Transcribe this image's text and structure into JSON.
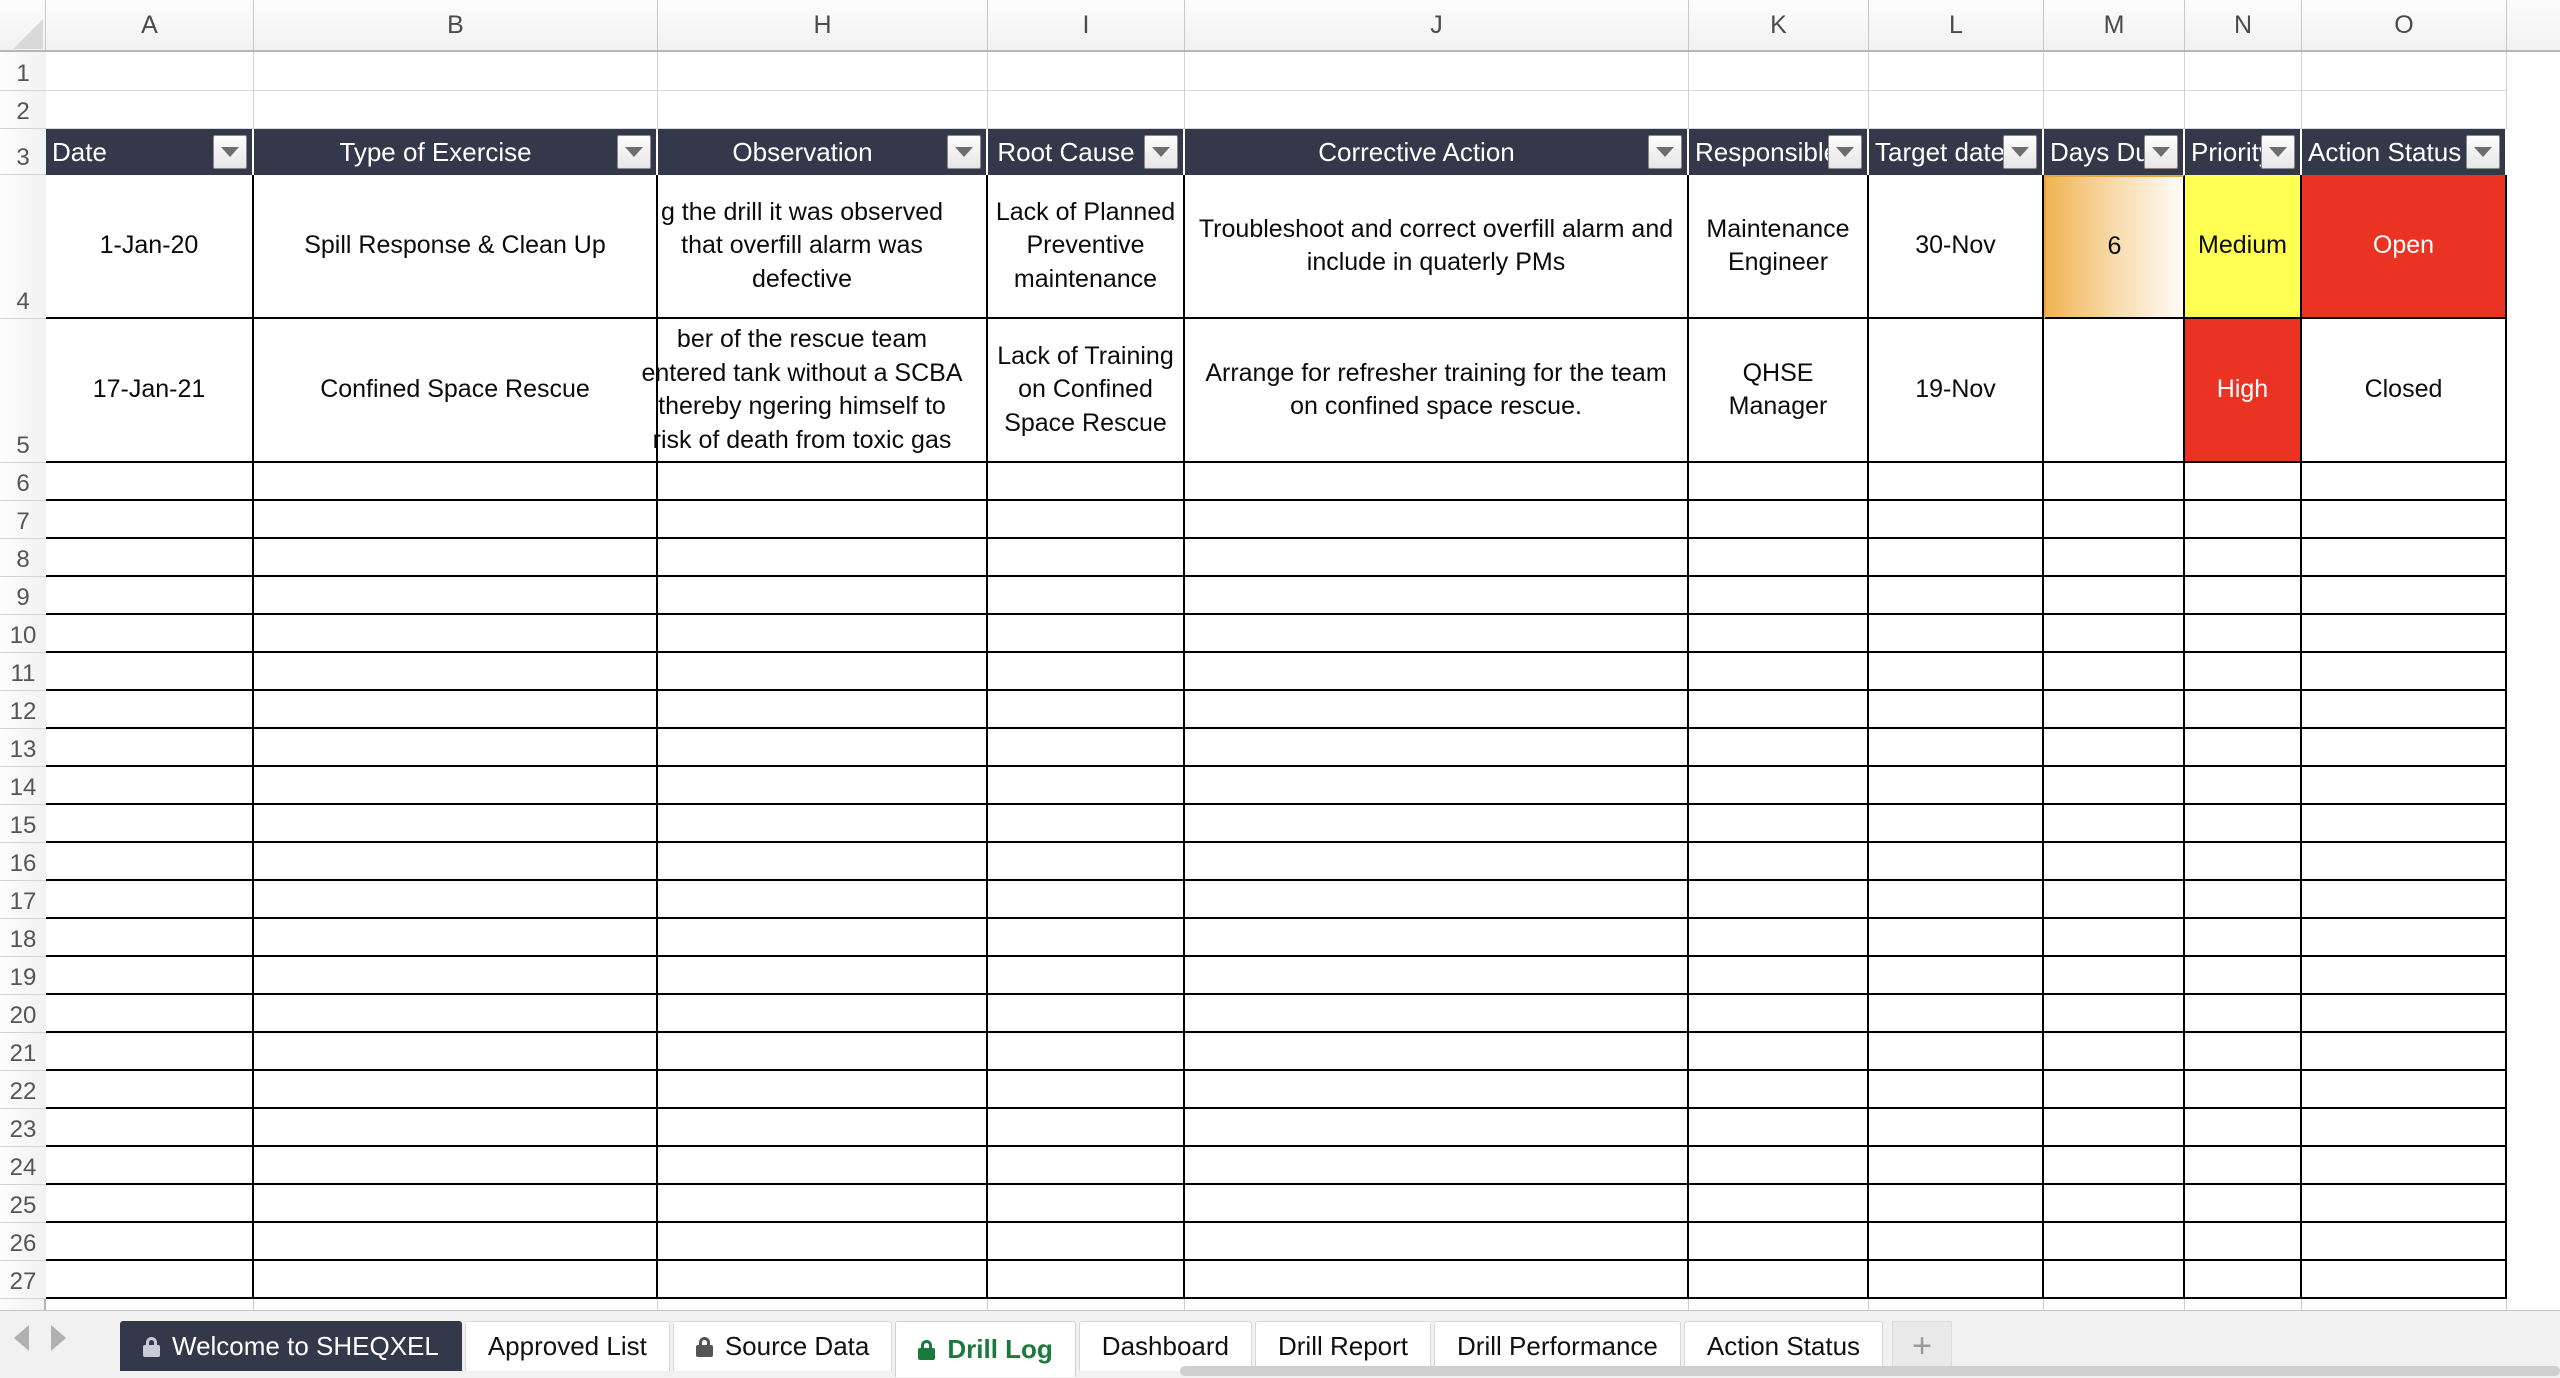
{
  "grid": {
    "column_letters": [
      "A",
      "B",
      "H",
      "I",
      "J",
      "K",
      "L",
      "M",
      "N",
      "O"
    ],
    "row_numbers": [
      "1",
      "2",
      "3",
      "4",
      "5",
      "6",
      "7",
      "8",
      "9",
      "10",
      "11",
      "12",
      "13",
      "14",
      "15",
      "16",
      "17",
      "18",
      "19",
      "20",
      "21",
      "22",
      "23",
      "24",
      "25",
      "26",
      "27"
    ],
    "corner_name": "select-all-corner"
  },
  "table": {
    "header_bg": "#33394a",
    "headers": [
      {
        "key": "date",
        "label": "Date",
        "align": "left"
      },
      {
        "key": "type_of_exercise",
        "label": "Type of Exercise",
        "align": "center"
      },
      {
        "key": "observation",
        "label": "Observation",
        "align": "center"
      },
      {
        "key": "root_cause",
        "label": "Root Cause",
        "align": "center"
      },
      {
        "key": "corrective_action",
        "label": "Corrective Action",
        "align": "center"
      },
      {
        "key": "responsible",
        "label": "Responsible",
        "align": "left"
      },
      {
        "key": "target_date",
        "label": "Target date",
        "align": "left"
      },
      {
        "key": "days_due",
        "label": "Days Due",
        "align": "left"
      },
      {
        "key": "priority",
        "label": "Priority",
        "align": "left"
      },
      {
        "key": "action_status",
        "label": "Action Status",
        "align": "left"
      }
    ],
    "rows": [
      {
        "date": "1-Jan-20",
        "type_of_exercise": "Spill Response & Clean Up",
        "observation": "g the drill it was observed that overfill alarm was defective",
        "root_cause": "Lack of Planned Preventive maintenance",
        "corrective_action": "Troubleshoot and correct overfill alarm and include in quaterly PMs",
        "responsible": "Maintenance Engineer",
        "target_date": "30-Nov",
        "days_due": "6",
        "priority": "Medium",
        "action_status": "Open",
        "days_due_style": "databar",
        "priority_style": "yellow",
        "action_status_style": "red"
      },
      {
        "date": "17-Jan-21",
        "type_of_exercise": "Confined Space Rescue",
        "observation": "ber of the rescue team entered tank without a SCBA thereby ngering himself to risk of death from toxic gas",
        "root_cause": "Lack of Training on Confined Space Rescue",
        "corrective_action": "Arrange for refresher training for the team on confined space rescue.",
        "responsible": "QHSE Manager",
        "target_date": "19-Nov",
        "days_due": "",
        "priority": "High",
        "action_status": "Closed",
        "days_due_style": "plain",
        "priority_style": "red",
        "action_status_style": "green"
      }
    ],
    "empty_row_count": 22
  },
  "colors": {
    "header": "#33394a",
    "yellow": "#ffff54",
    "red": "#ea3323",
    "green": "#4aa css",
    "databar_start": "#f0b354",
    "databar_end": "#fffcf7",
    "active_tab_text": "#1a7a3c"
  },
  "tabbar": {
    "prev_label": "prev-sheet",
    "next_label": "next-sheet",
    "add_label": "+",
    "tabs": [
      {
        "label": "Welcome to SHEQXEL",
        "locked": true,
        "state": "dark"
      },
      {
        "label": "Approved List",
        "locked": false,
        "state": "normal"
      },
      {
        "label": "Source Data",
        "locked": true,
        "state": "normal"
      },
      {
        "label": "Drill Log",
        "locked": true,
        "state": "active"
      },
      {
        "label": "Dashboard",
        "locked": false,
        "state": "normal"
      },
      {
        "label": "Drill Report",
        "locked": false,
        "state": "normal"
      },
      {
        "label": "Drill Performance",
        "locked": false,
        "state": "normal"
      },
      {
        "label": "Action Status",
        "locked": false,
        "state": "normal"
      }
    ]
  }
}
